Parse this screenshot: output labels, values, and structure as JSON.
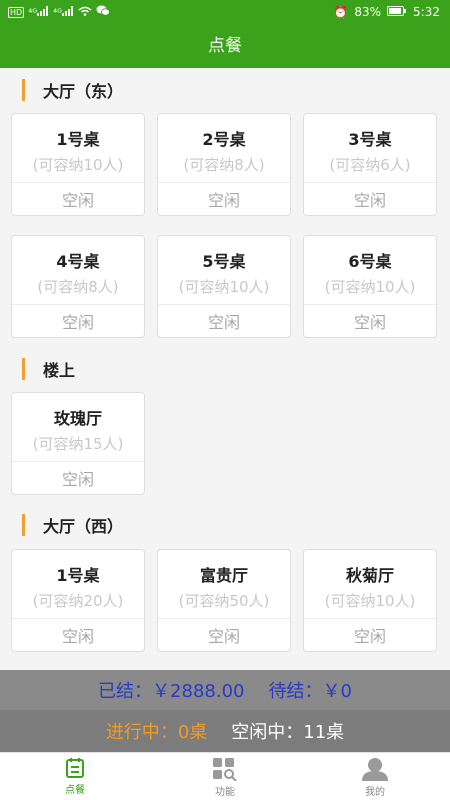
{
  "status_bar": {
    "left_icons": [
      "hd-icon",
      "signal-4g-icon",
      "signal-4g-icon",
      "wifi-icon",
      "wechat-icon"
    ],
    "left_texts": [
      "HD",
      "⁴ᴳ",
      "⁴ᴳ"
    ],
    "alarm": "⏰",
    "battery": "83%",
    "time": "5:32"
  },
  "header": {
    "title": "点餐"
  },
  "sections": [
    {
      "title": "大厅（东）",
      "tables": [
        {
          "name": "1号桌",
          "capacity": "(可容纳10人)",
          "status": "空闲"
        },
        {
          "name": "2号桌",
          "capacity": "(可容纳8人)",
          "status": "空闲"
        },
        {
          "name": "3号桌",
          "capacity": "(可容纳6人)",
          "status": "空闲"
        },
        {
          "name": "4号桌",
          "capacity": "(可容纳8人)",
          "status": "空闲"
        },
        {
          "name": "5号桌",
          "capacity": "(可容纳10人)",
          "status": "空闲"
        },
        {
          "name": "6号桌",
          "capacity": "(可容纳10人)",
          "status": "空闲"
        }
      ]
    },
    {
      "title": "楼上",
      "tables": [
        {
          "name": "玫瑰厅",
          "capacity": "(可容纳15人)",
          "status": "空闲"
        }
      ]
    },
    {
      "title": "大厅（西）",
      "tables": [
        {
          "name": "1号桌",
          "capacity": "(可容纳20人)",
          "status": "空闲"
        },
        {
          "name": "富贵厅",
          "capacity": "(可容纳50人)",
          "status": "空闲"
        },
        {
          "name": "秋菊厅",
          "capacity": "(可容纳10人)",
          "status": "空闲"
        }
      ]
    }
  ],
  "summary": {
    "settled_label": "已结：",
    "settled_value": "￥2888.00",
    "pending_label": "待结：",
    "pending_value": "￥0",
    "in_progress_label": "进行中：",
    "in_progress_value": "0桌",
    "idle_label": "空闲中：",
    "idle_value": "11桌"
  },
  "bottom_nav": [
    {
      "label": "点餐",
      "icon": "order-list-icon",
      "active": true
    },
    {
      "label": "功能",
      "icon": "grid-search-icon",
      "active": false
    },
    {
      "label": "我的",
      "icon": "person-icon",
      "active": false
    }
  ],
  "colors": {
    "brand": "#3aa21b",
    "section_accent": "#f0a030",
    "settled_text": "#2a39c9",
    "in_progress_text": "#f39a22"
  }
}
